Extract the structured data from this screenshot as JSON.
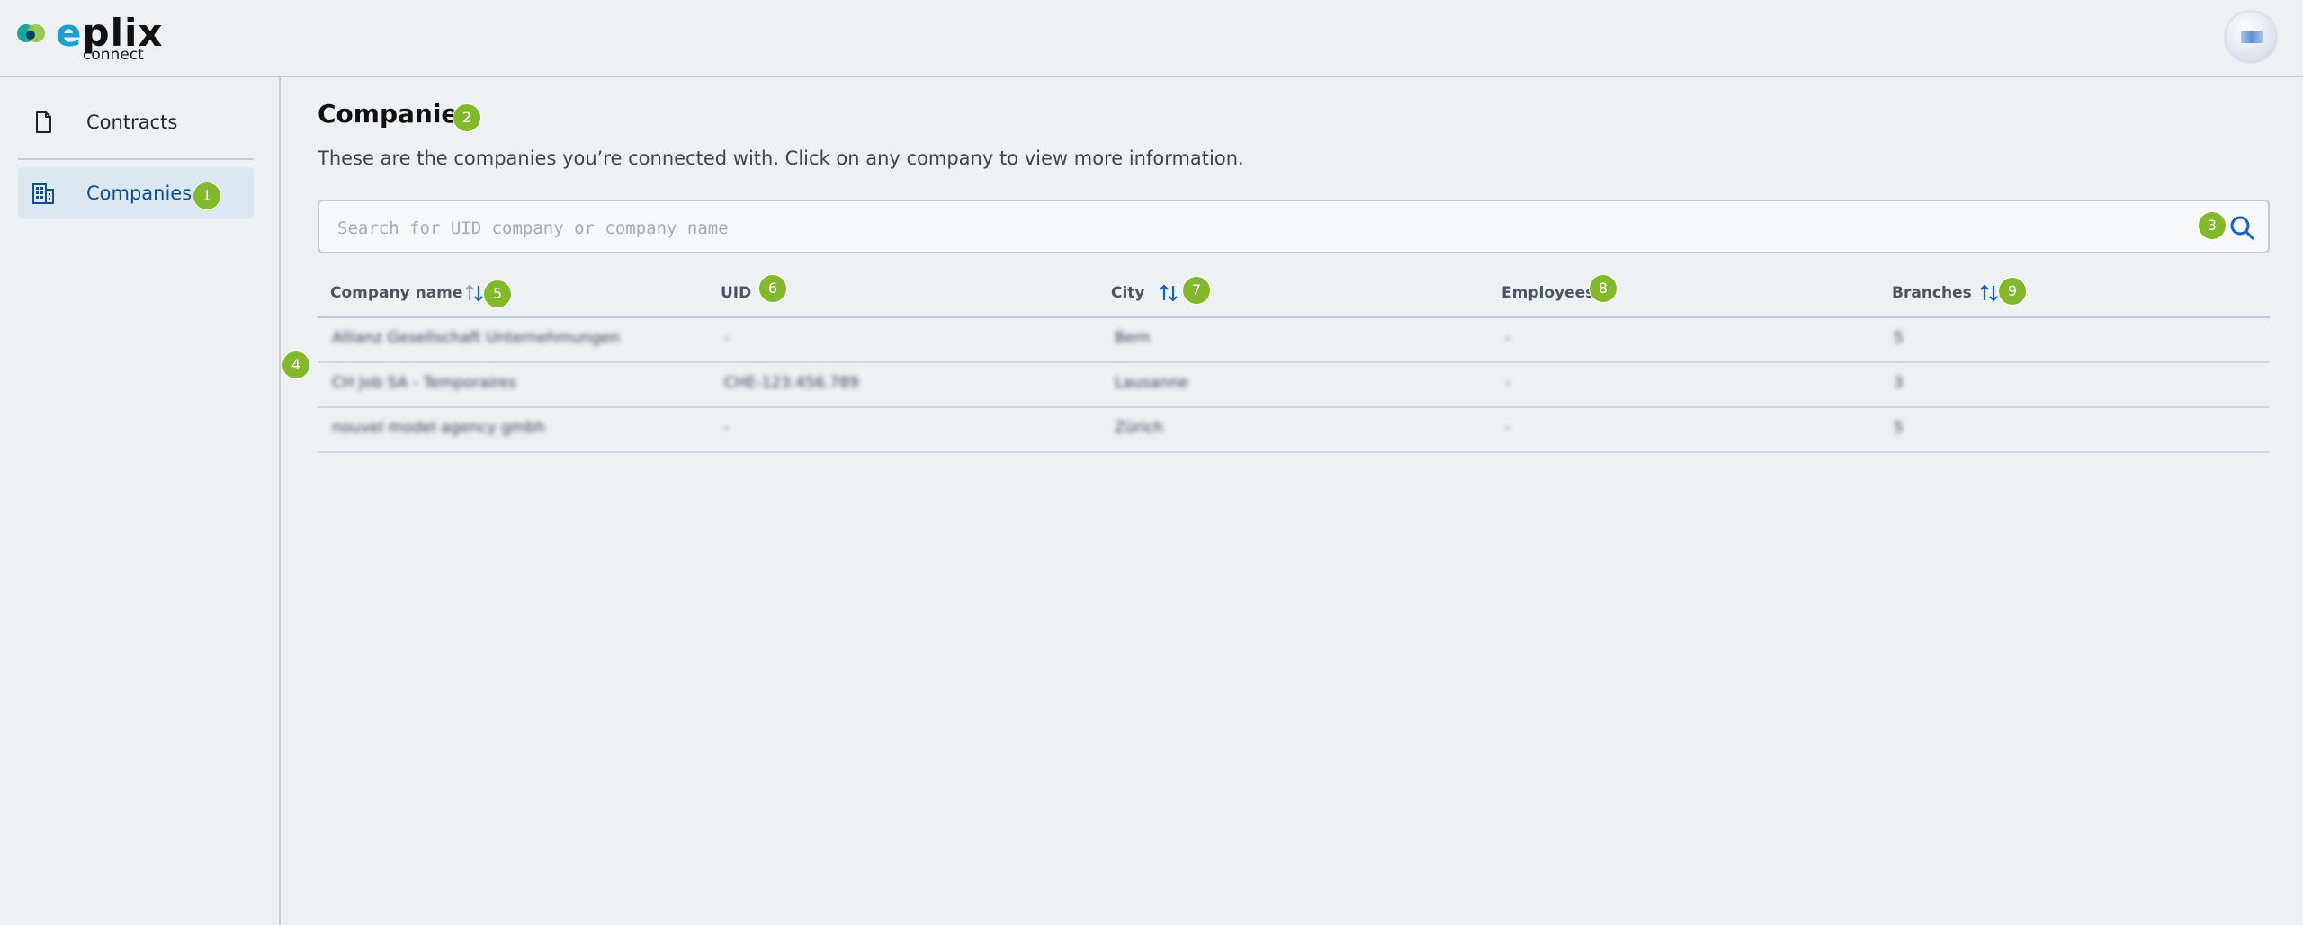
{
  "header": {
    "logo": {
      "brand": "eplix",
      "sub": "connect"
    },
    "avatar_icon": "user-avatar-icon"
  },
  "sidebar": {
    "items": [
      {
        "label": "Contracts",
        "icon": "document-icon",
        "active": false
      },
      {
        "label": "Companies",
        "icon": "building-icon",
        "active": true
      }
    ]
  },
  "main": {
    "title": "Companies",
    "subtitle": "These are the companies you’re connected with. Click on any company to view more information.",
    "search": {
      "placeholder": "Search for UID company or company name"
    },
    "columns": [
      "Company name",
      "UID",
      "City",
      "Employees",
      "Branches"
    ],
    "rows": [
      [
        "Allianz Gesellschaft Unternehmungen",
        "-",
        "Bern",
        "-",
        "5"
      ],
      [
        "CH Job SA - Temporaires",
        "CHE-123.456.789",
        "Lausanne",
        "-",
        "3"
      ],
      [
        "nouvel model agency gmbh",
        "-",
        "Zürich",
        "-",
        "5"
      ]
    ]
  },
  "badges": [
    "1",
    "2",
    "3",
    "4",
    "5",
    "6",
    "7",
    "8",
    "9"
  ],
  "colors": {
    "accent": "#0e4f8f",
    "badge": "#84b82c",
    "sort_arrow": "#1565c0"
  }
}
